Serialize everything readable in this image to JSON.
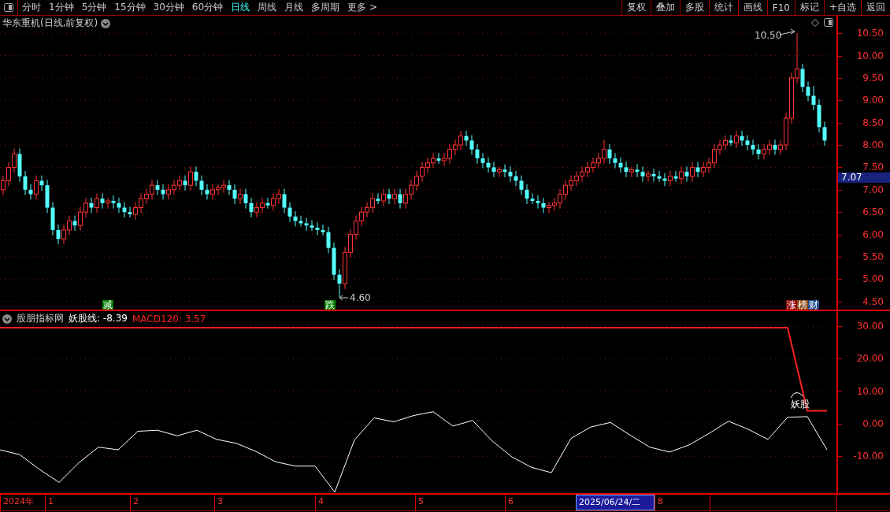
{
  "toolbar": {
    "periods": [
      {
        "label": "分时",
        "selected": false
      },
      {
        "label": "1分钟",
        "selected": false
      },
      {
        "label": "5分钟",
        "selected": false
      },
      {
        "label": "15分钟",
        "selected": false
      },
      {
        "label": "30分钟",
        "selected": false
      },
      {
        "label": "60分钟",
        "selected": false
      },
      {
        "label": "日线",
        "selected": true
      },
      {
        "label": "周线",
        "selected": false
      },
      {
        "label": "月线",
        "selected": false
      },
      {
        "label": "多周期",
        "selected": false
      },
      {
        "label": "更多 >",
        "selected": false
      }
    ],
    "buttons": [
      "复权",
      "叠加",
      "多股",
      "统计",
      "画线",
      "F10",
      "标记",
      "+自选",
      "返回"
    ]
  },
  "main_chart": {
    "title": "华东重机(日线,前复权)",
    "current_price": "7.07",
    "high_marker": "10.50",
    "low_marker": "4.60",
    "signals": [
      {
        "label": "减",
        "color": "#008000"
      },
      {
        "label": "跌",
        "color": "#008000"
      }
    ],
    "tags": [
      {
        "label": "涨",
        "color": "#8b0000"
      },
      {
        "label": "榜",
        "color": "#8b4a13"
      },
      {
        "label": "财",
        "color": "#1c4a8a"
      }
    ],
    "chart_data": {
      "type": "candlestick",
      "ylim": [
        4.32,
        10.89
      ],
      "grid": true,
      "yticks": [
        {
          "value": 10.5,
          "label": "10.50"
        },
        {
          "value": 10,
          "label": "10.00"
        },
        {
          "value": 9.5,
          "label": "9.50"
        },
        {
          "value": 9,
          "label": "9.00"
        },
        {
          "value": 8.5,
          "label": "8.50"
        },
        {
          "value": 8,
          "label": "8.00"
        },
        {
          "value": 7.5,
          "label": "7.50"
        },
        {
          "value": 7,
          "label": "7.00"
        },
        {
          "value": 6.5,
          "label": "6.50"
        },
        {
          "value": 6,
          "label": "6.00"
        },
        {
          "value": 5.5,
          "label": "5.50"
        },
        {
          "value": 5,
          "label": "5.00"
        },
        {
          "value": 4.5,
          "label": "4.50"
        }
      ],
      "ohlc": [
        [
          7.0,
          7.32,
          6.88,
          7.2
        ],
        [
          7.2,
          7.62,
          7.08,
          7.5
        ],
        [
          7.5,
          7.92,
          7.38,
          7.8
        ],
        [
          7.8,
          7.92,
          7.18,
          7.3
        ],
        [
          7.3,
          7.42,
          6.88,
          7.0
        ],
        [
          7.0,
          7.12,
          6.78,
          6.9
        ],
        [
          6.9,
          7.32,
          6.78,
          7.2
        ],
        [
          7.2,
          7.32,
          6.98,
          7.1
        ],
        [
          7.1,
          7.22,
          6.48,
          6.6
        ],
        [
          6.6,
          6.72,
          5.98,
          6.1
        ],
        [
          6.1,
          6.22,
          5.78,
          5.9
        ],
        [
          5.9,
          6.22,
          5.78,
          6.1
        ],
        [
          6.1,
          6.42,
          5.98,
          6.3
        ],
        [
          6.3,
          6.42,
          6.08,
          6.2
        ],
        [
          6.2,
          6.62,
          6.08,
          6.5
        ],
        [
          6.5,
          6.82,
          6.38,
          6.7
        ],
        [
          6.7,
          6.82,
          6.48,
          6.6
        ],
        [
          6.6,
          6.92,
          6.48,
          6.8
        ],
        [
          6.8,
          6.92,
          6.58,
          6.7
        ],
        [
          6.7,
          6.82,
          6.58,
          6.75
        ],
        [
          6.75,
          6.87,
          6.58,
          6.7
        ],
        [
          6.7,
          6.82,
          6.48,
          6.6
        ],
        [
          6.6,
          6.72,
          6.38,
          6.5
        ],
        [
          6.5,
          6.62,
          6.38,
          6.45
        ],
        [
          6.45,
          6.72,
          6.33,
          6.6
        ],
        [
          6.6,
          6.92,
          6.48,
          6.8
        ],
        [
          6.8,
          7.02,
          6.68,
          6.9
        ],
        [
          6.9,
          7.22,
          6.78,
          7.1
        ],
        [
          7.1,
          7.22,
          6.88,
          7.0
        ],
        [
          7.0,
          7.12,
          6.78,
          6.9
        ],
        [
          6.9,
          7.12,
          6.78,
          7.0
        ],
        [
          7.0,
          7.22,
          6.88,
          7.1
        ],
        [
          7.1,
          7.32,
          6.98,
          7.2
        ],
        [
          7.2,
          7.32,
          6.98,
          7.1
        ],
        [
          7.1,
          7.52,
          6.98,
          7.4
        ],
        [
          7.4,
          7.52,
          7.08,
          7.2
        ],
        [
          7.2,
          7.32,
          6.88,
          7.0
        ],
        [
          7.0,
          7.12,
          6.78,
          6.9
        ],
        [
          6.9,
          7.12,
          6.78,
          7.0
        ],
        [
          7.0,
          7.12,
          6.88,
          7.05
        ],
        [
          7.05,
          7.22,
          6.93,
          7.1
        ],
        [
          7.1,
          7.22,
          6.88,
          7.0
        ],
        [
          7.0,
          7.12,
          6.68,
          6.8
        ],
        [
          6.8,
          7.02,
          6.68,
          6.9
        ],
        [
          6.9,
          7.02,
          6.58,
          6.7
        ],
        [
          6.7,
          6.82,
          6.38,
          6.5
        ],
        [
          6.5,
          6.72,
          6.38,
          6.6
        ],
        [
          6.6,
          6.82,
          6.48,
          6.7
        ],
        [
          6.7,
          6.82,
          6.58,
          6.65
        ],
        [
          6.65,
          6.92,
          6.53,
          6.8
        ],
        [
          6.8,
          7.02,
          6.68,
          6.9
        ],
        [
          6.9,
          7.02,
          6.48,
          6.6
        ],
        [
          6.6,
          6.72,
          6.28,
          6.4
        ],
        [
          6.4,
          6.52,
          6.18,
          6.3
        ],
        [
          6.3,
          6.42,
          6.18,
          6.25
        ],
        [
          6.25,
          6.37,
          6.08,
          6.2
        ],
        [
          6.2,
          6.32,
          6.08,
          6.15
        ],
        [
          6.15,
          6.27,
          5.98,
          6.1
        ],
        [
          6.1,
          6.22,
          5.98,
          6.05
        ],
        [
          6.05,
          6.17,
          5.58,
          5.7
        ],
        [
          5.7,
          5.82,
          4.98,
          5.1
        ],
        [
          5.1,
          5.22,
          4.6,
          4.9
        ],
        [
          4.9,
          5.72,
          4.78,
          5.6
        ],
        [
          5.6,
          6.12,
          5.48,
          6.0
        ],
        [
          6.0,
          6.42,
          5.88,
          6.3
        ],
        [
          6.3,
          6.62,
          6.18,
          6.5
        ],
        [
          6.5,
          6.72,
          6.38,
          6.6
        ],
        [
          6.6,
          6.92,
          6.48,
          6.8
        ],
        [
          6.8,
          6.92,
          6.68,
          6.75
        ],
        [
          6.75,
          7.02,
          6.63,
          6.9
        ],
        [
          6.9,
          7.02,
          6.68,
          6.8
        ],
        [
          6.8,
          7.02,
          6.68,
          6.9
        ],
        [
          6.9,
          7.02,
          6.58,
          6.7
        ],
        [
          6.7,
          7.02,
          6.58,
          6.9
        ],
        [
          6.9,
          7.22,
          6.78,
          7.1
        ],
        [
          7.1,
          7.42,
          6.98,
          7.3
        ],
        [
          7.3,
          7.62,
          7.18,
          7.5
        ],
        [
          7.5,
          7.72,
          7.38,
          7.6
        ],
        [
          7.6,
          7.82,
          7.48,
          7.7
        ],
        [
          7.7,
          7.82,
          7.58,
          7.65
        ],
        [
          7.65,
          7.82,
          7.53,
          7.7
        ],
        [
          7.7,
          8.02,
          7.58,
          7.9
        ],
        [
          7.9,
          8.12,
          7.78,
          8.0
        ],
        [
          8.0,
          8.32,
          7.88,
          8.2
        ],
        [
          8.2,
          8.32,
          7.98,
          8.1
        ],
        [
          8.1,
          8.22,
          7.78,
          7.9
        ],
        [
          7.9,
          8.02,
          7.58,
          7.7
        ],
        [
          7.7,
          7.82,
          7.48,
          7.6
        ],
        [
          7.6,
          7.72,
          7.38,
          7.5
        ],
        [
          7.5,
          7.62,
          7.28,
          7.4
        ],
        [
          7.4,
          7.52,
          7.28,
          7.45
        ],
        [
          7.45,
          7.57,
          7.28,
          7.4
        ],
        [
          7.4,
          7.52,
          7.18,
          7.3
        ],
        [
          7.3,
          7.42,
          7.08,
          7.2
        ],
        [
          7.2,
          7.32,
          6.88,
          7.0
        ],
        [
          7.0,
          7.12,
          6.68,
          6.8
        ],
        [
          6.8,
          6.92,
          6.68,
          6.75
        ],
        [
          6.75,
          6.87,
          6.58,
          6.7
        ],
        [
          6.7,
          6.82,
          6.48,
          6.6
        ],
        [
          6.6,
          6.72,
          6.48,
          6.65
        ],
        [
          6.65,
          6.82,
          6.53,
          6.7
        ],
        [
          6.7,
          7.02,
          6.58,
          6.9
        ],
        [
          6.9,
          7.22,
          6.78,
          7.1
        ],
        [
          7.1,
          7.32,
          6.98,
          7.2
        ],
        [
          7.2,
          7.42,
          7.08,
          7.3
        ],
        [
          7.3,
          7.52,
          7.18,
          7.4
        ],
        [
          7.4,
          7.62,
          7.28,
          7.5
        ],
        [
          7.5,
          7.72,
          7.38,
          7.6
        ],
        [
          7.6,
          7.82,
          7.48,
          7.7
        ],
        [
          7.7,
          8.12,
          7.58,
          7.9
        ],
        [
          7.9,
          8.02,
          7.58,
          7.7
        ],
        [
          7.7,
          7.82,
          7.48,
          7.6
        ],
        [
          7.6,
          7.72,
          7.38,
          7.5
        ],
        [
          7.5,
          7.62,
          7.28,
          7.4
        ],
        [
          7.4,
          7.52,
          7.28,
          7.45
        ],
        [
          7.45,
          7.57,
          7.28,
          7.4
        ],
        [
          7.4,
          7.52,
          7.18,
          7.3
        ],
        [
          7.3,
          7.42,
          7.18,
          7.35
        ],
        [
          7.35,
          7.47,
          7.18,
          7.3
        ],
        [
          7.3,
          7.42,
          7.18,
          7.25
        ],
        [
          7.25,
          7.37,
          7.08,
          7.2
        ],
        [
          7.2,
          7.42,
          7.08,
          7.3
        ],
        [
          7.3,
          7.42,
          7.18,
          7.25
        ],
        [
          7.25,
          7.52,
          7.13,
          7.4
        ],
        [
          7.4,
          7.52,
          7.18,
          7.3
        ],
        [
          7.3,
          7.62,
          7.18,
          7.5
        ],
        [
          7.5,
          7.62,
          7.28,
          7.4
        ],
        [
          7.4,
          7.62,
          7.28,
          7.5
        ],
        [
          7.5,
          7.72,
          7.38,
          7.6
        ],
        [
          7.6,
          8.02,
          7.48,
          7.9
        ],
        [
          7.9,
          8.12,
          7.78,
          8.0
        ],
        [
          8.0,
          8.22,
          7.88,
          8.1
        ],
        [
          8.1,
          8.22,
          7.98,
          8.05
        ],
        [
          8.05,
          8.32,
          7.93,
          8.2
        ],
        [
          8.2,
          8.32,
          7.98,
          8.1
        ],
        [
          8.1,
          8.22,
          7.88,
          8.0
        ],
        [
          8.0,
          8.12,
          7.78,
          7.9
        ],
        [
          7.9,
          8.02,
          7.68,
          7.8
        ],
        [
          7.8,
          8.02,
          7.68,
          7.9
        ],
        [
          7.9,
          8.12,
          7.78,
          8.0
        ],
        [
          8.0,
          8.12,
          7.78,
          7.9
        ],
        [
          7.9,
          8.12,
          7.78,
          8.0
        ],
        [
          8.0,
          8.72,
          7.88,
          8.6
        ],
        [
          8.6,
          9.62,
          8.48,
          9.5
        ],
        [
          9.5,
          10.5,
          9.38,
          9.7
        ],
        [
          9.7,
          9.82,
          9.18,
          9.3
        ],
        [
          9.3,
          9.42,
          8.98,
          9.1
        ],
        [
          9.1,
          9.32,
          8.78,
          8.9
        ],
        [
          8.9,
          9.02,
          8.28,
          8.4
        ],
        [
          8.4,
          8.52,
          7.98,
          8.1
        ]
      ]
    }
  },
  "indicator": {
    "source": "股朋指标网",
    "legend_values": [
      ": -8.39",
      ": 3.57"
    ],
    "callout": "妖股",
    "chart_data": {
      "type": "line",
      "ylim": [
        -21.3,
        34.6
      ],
      "grid": true,
      "yticks": [
        {
          "value": 30,
          "label": "30.00"
        },
        {
          "value": 20,
          "label": "20.00"
        },
        {
          "value": 10,
          "label": "10.00"
        },
        {
          "value": 0,
          "label": "0.00"
        },
        {
          "value": -10,
          "label": "-10.00"
        }
      ],
      "series": [
        {
          "name": "妖股线",
          "color": "#ffffff",
          "values": [
            -8,
            -9.5,
            -14,
            -18,
            -12,
            -7.2,
            -8,
            -2.3,
            -2,
            -3.7,
            -2,
            -4.8,
            -6,
            -8.5,
            -11.7,
            -13,
            -13,
            -21,
            -5,
            1.8,
            0.6,
            2.5,
            3.7,
            -0.7,
            1,
            -5.3,
            -10.2,
            -13.4,
            -15,
            -4.5,
            -1,
            0.4,
            -3.5,
            -7.2,
            -8.7,
            -6.5,
            -3,
            0.8,
            -1.7,
            -4.8,
            2,
            2.2,
            -8
          ]
        },
        {
          "name": "MACD120",
          "color": "#ff2020",
          "values": [
            29.5,
            29.5,
            29.5,
            29.5,
            29.5,
            29.5,
            29.5,
            29.5,
            29.5,
            29.5,
            29.5,
            29.5,
            29.5,
            29.5,
            29.5,
            29.5,
            29.5,
            29.5,
            29.5,
            29.5,
            29.5,
            29.5,
            29.5,
            29.5,
            29.5,
            29.5,
            29.5,
            29.5,
            29.5,
            29.5,
            29.5,
            29.5,
            29.5,
            29.5,
            29.5,
            29.5,
            29.5,
            29.5,
            29.5,
            29.5,
            29.5,
            4,
            4
          ]
        }
      ]
    }
  },
  "time_axis": [
    {
      "label": "2024年",
      "selected": false
    },
    {
      "label": "1",
      "selected": false
    },
    {
      "label": "2",
      "selected": false
    },
    {
      "label": "3",
      "selected": false
    },
    {
      "label": "4",
      "selected": false
    },
    {
      "label": "5",
      "selected": false
    },
    {
      "label": "6",
      "selected": false
    },
    {
      "label": "2025/06/24/二",
      "selected": true
    },
    {
      "label": "8",
      "selected": false
    }
  ]
}
